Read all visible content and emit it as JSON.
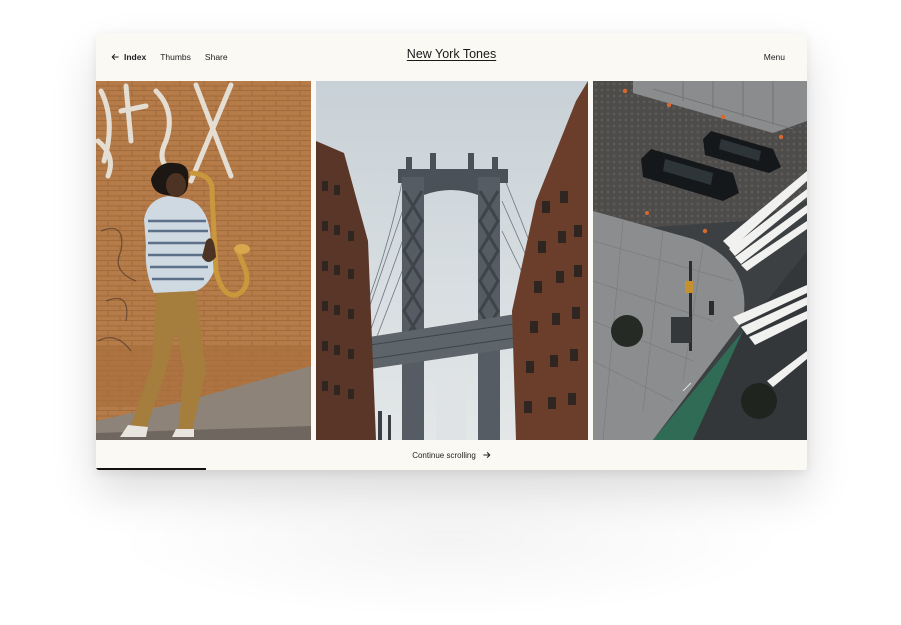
{
  "header": {
    "nav": [
      {
        "label": "Index",
        "active": true,
        "icon": "arrow-left-icon"
      },
      {
        "label": "Thumbs",
        "active": false
      },
      {
        "label": "Share",
        "active": false
      }
    ],
    "title": "New York Tones",
    "menu_label": "Menu"
  },
  "gallery": {
    "photos": [
      {
        "subject": "saxophone player in front of graffiti brick wall"
      },
      {
        "subject": "Manhattan Bridge between brick buildings"
      },
      {
        "subject": "aerial street view with parked cars and crosswalk"
      }
    ]
  },
  "footer": {
    "continue_label": "Continue scrolling",
    "continue_icon": "arrow-right-icon",
    "scroll_progress": 0.155
  },
  "colors": {
    "background": "#fbf9f4",
    "text": "#222222",
    "progress": "#111111"
  }
}
